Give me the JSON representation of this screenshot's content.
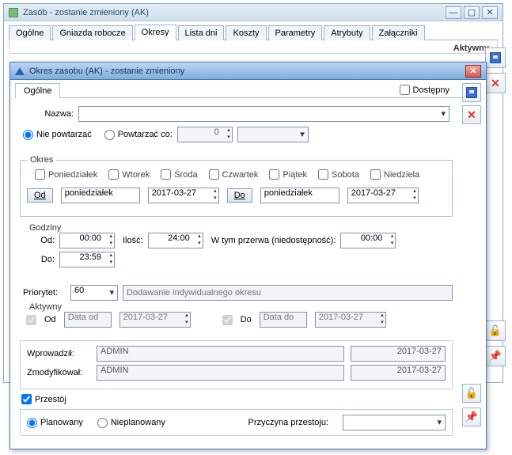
{
  "parent": {
    "title": "Zasób - zostanie zmieniony (AK)",
    "tabs": [
      "Ogólne",
      "Gniazda robocze",
      "Okresy",
      "Lista dni",
      "Koszty",
      "Parametry",
      "Atrybuty",
      "Załączniki"
    ],
    "active_tab_index": 2,
    "status_label": "Aktywny"
  },
  "modal": {
    "title": "Okres zasobu (AK) - zostanie zmieniony",
    "sub_tab": "Ogólne",
    "dostepny_label": "Dostępny",
    "nazwa_label": "Nazwa:",
    "nazwa_value": "",
    "repeat": {
      "no_repeat_label": "Nie powtarzać",
      "repeat_every_label": "Powtarzać co:",
      "repeat_value": "0",
      "repeat_unit": ""
    },
    "okres": {
      "legend": "Okres",
      "days": [
        "Poniedziałek",
        "Wtorek",
        "Środa",
        "Czwartek",
        "Piątek",
        "Sobota",
        "Niedziela"
      ],
      "od_btn": "Od",
      "do_btn": "Do",
      "od_day": "poniedziałek",
      "do_day": "poniedziałek",
      "od_date": "2017-03-27",
      "do_date": "2017-03-27"
    },
    "godziny": {
      "legend": "Godziny",
      "od_label": "Od:",
      "do_label": "Do:",
      "od_value": "00:00",
      "do_value": "23:59",
      "ilosc_label": "Ilość:",
      "ilosc_value": "24:00",
      "przerwa_label": "W tym przerwa (niedostępność):",
      "przerwa_value": "00:00"
    },
    "priorytet_label": "Priorytet:",
    "priorytet_value": "60",
    "priorytet_placeholder": "Dodawanie indywidualnego okresu",
    "aktywny": {
      "legend": "Aktywny",
      "od_label": "Od",
      "do_label": "Do",
      "data_od_label": "Data od",
      "data_do_label": "Data do",
      "od_date": "2017-03-27",
      "do_date": "2017-03-27"
    },
    "audit": {
      "wprowadzil_label": "Wprowadził:",
      "zmodyfikowal_label": "Zmodyfikował:",
      "user": "ADMIN",
      "date": "2017-03-27"
    },
    "przestoj": {
      "head_label": "Przestój",
      "planowany": "Planowany",
      "nieplanowany": "Nieplanowany",
      "przyczyna_label": "Przyczyna przestoju:",
      "przyczyna_value": ""
    }
  }
}
